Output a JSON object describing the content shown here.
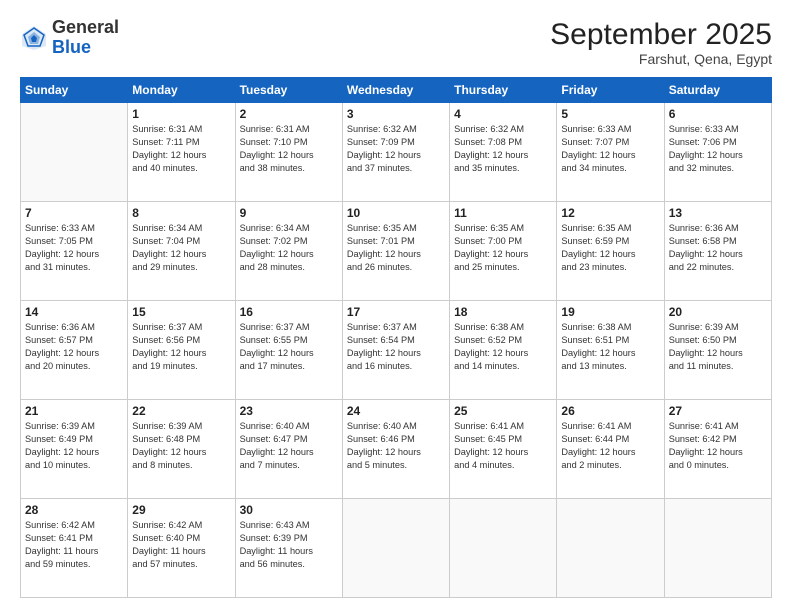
{
  "logo": {
    "general": "General",
    "blue": "Blue"
  },
  "header": {
    "month": "September 2025",
    "location": "Farshut, Qena, Egypt"
  },
  "weekdays": [
    "Sunday",
    "Monday",
    "Tuesday",
    "Wednesday",
    "Thursday",
    "Friday",
    "Saturday"
  ],
  "weeks": [
    [
      {
        "day": null,
        "info": null
      },
      {
        "day": "1",
        "info": "Sunrise: 6:31 AM\nSunset: 7:11 PM\nDaylight: 12 hours\nand 40 minutes."
      },
      {
        "day": "2",
        "info": "Sunrise: 6:31 AM\nSunset: 7:10 PM\nDaylight: 12 hours\nand 38 minutes."
      },
      {
        "day": "3",
        "info": "Sunrise: 6:32 AM\nSunset: 7:09 PM\nDaylight: 12 hours\nand 37 minutes."
      },
      {
        "day": "4",
        "info": "Sunrise: 6:32 AM\nSunset: 7:08 PM\nDaylight: 12 hours\nand 35 minutes."
      },
      {
        "day": "5",
        "info": "Sunrise: 6:33 AM\nSunset: 7:07 PM\nDaylight: 12 hours\nand 34 minutes."
      },
      {
        "day": "6",
        "info": "Sunrise: 6:33 AM\nSunset: 7:06 PM\nDaylight: 12 hours\nand 32 minutes."
      }
    ],
    [
      {
        "day": "7",
        "info": "Sunrise: 6:33 AM\nSunset: 7:05 PM\nDaylight: 12 hours\nand 31 minutes."
      },
      {
        "day": "8",
        "info": "Sunrise: 6:34 AM\nSunset: 7:04 PM\nDaylight: 12 hours\nand 29 minutes."
      },
      {
        "day": "9",
        "info": "Sunrise: 6:34 AM\nSunset: 7:02 PM\nDaylight: 12 hours\nand 28 minutes."
      },
      {
        "day": "10",
        "info": "Sunrise: 6:35 AM\nSunset: 7:01 PM\nDaylight: 12 hours\nand 26 minutes."
      },
      {
        "day": "11",
        "info": "Sunrise: 6:35 AM\nSunset: 7:00 PM\nDaylight: 12 hours\nand 25 minutes."
      },
      {
        "day": "12",
        "info": "Sunrise: 6:35 AM\nSunset: 6:59 PM\nDaylight: 12 hours\nand 23 minutes."
      },
      {
        "day": "13",
        "info": "Sunrise: 6:36 AM\nSunset: 6:58 PM\nDaylight: 12 hours\nand 22 minutes."
      }
    ],
    [
      {
        "day": "14",
        "info": "Sunrise: 6:36 AM\nSunset: 6:57 PM\nDaylight: 12 hours\nand 20 minutes."
      },
      {
        "day": "15",
        "info": "Sunrise: 6:37 AM\nSunset: 6:56 PM\nDaylight: 12 hours\nand 19 minutes."
      },
      {
        "day": "16",
        "info": "Sunrise: 6:37 AM\nSunset: 6:55 PM\nDaylight: 12 hours\nand 17 minutes."
      },
      {
        "day": "17",
        "info": "Sunrise: 6:37 AM\nSunset: 6:54 PM\nDaylight: 12 hours\nand 16 minutes."
      },
      {
        "day": "18",
        "info": "Sunrise: 6:38 AM\nSunset: 6:52 PM\nDaylight: 12 hours\nand 14 minutes."
      },
      {
        "day": "19",
        "info": "Sunrise: 6:38 AM\nSunset: 6:51 PM\nDaylight: 12 hours\nand 13 minutes."
      },
      {
        "day": "20",
        "info": "Sunrise: 6:39 AM\nSunset: 6:50 PM\nDaylight: 12 hours\nand 11 minutes."
      }
    ],
    [
      {
        "day": "21",
        "info": "Sunrise: 6:39 AM\nSunset: 6:49 PM\nDaylight: 12 hours\nand 10 minutes."
      },
      {
        "day": "22",
        "info": "Sunrise: 6:39 AM\nSunset: 6:48 PM\nDaylight: 12 hours\nand 8 minutes."
      },
      {
        "day": "23",
        "info": "Sunrise: 6:40 AM\nSunset: 6:47 PM\nDaylight: 12 hours\nand 7 minutes."
      },
      {
        "day": "24",
        "info": "Sunrise: 6:40 AM\nSunset: 6:46 PM\nDaylight: 12 hours\nand 5 minutes."
      },
      {
        "day": "25",
        "info": "Sunrise: 6:41 AM\nSunset: 6:45 PM\nDaylight: 12 hours\nand 4 minutes."
      },
      {
        "day": "26",
        "info": "Sunrise: 6:41 AM\nSunset: 6:44 PM\nDaylight: 12 hours\nand 2 minutes."
      },
      {
        "day": "27",
        "info": "Sunrise: 6:41 AM\nSunset: 6:42 PM\nDaylight: 12 hours\nand 0 minutes."
      }
    ],
    [
      {
        "day": "28",
        "info": "Sunrise: 6:42 AM\nSunset: 6:41 PM\nDaylight: 11 hours\nand 59 minutes."
      },
      {
        "day": "29",
        "info": "Sunrise: 6:42 AM\nSunset: 6:40 PM\nDaylight: 11 hours\nand 57 minutes."
      },
      {
        "day": "30",
        "info": "Sunrise: 6:43 AM\nSunset: 6:39 PM\nDaylight: 11 hours\nand 56 minutes."
      },
      {
        "day": null,
        "info": null
      },
      {
        "day": null,
        "info": null
      },
      {
        "day": null,
        "info": null
      },
      {
        "day": null,
        "info": null
      }
    ]
  ]
}
